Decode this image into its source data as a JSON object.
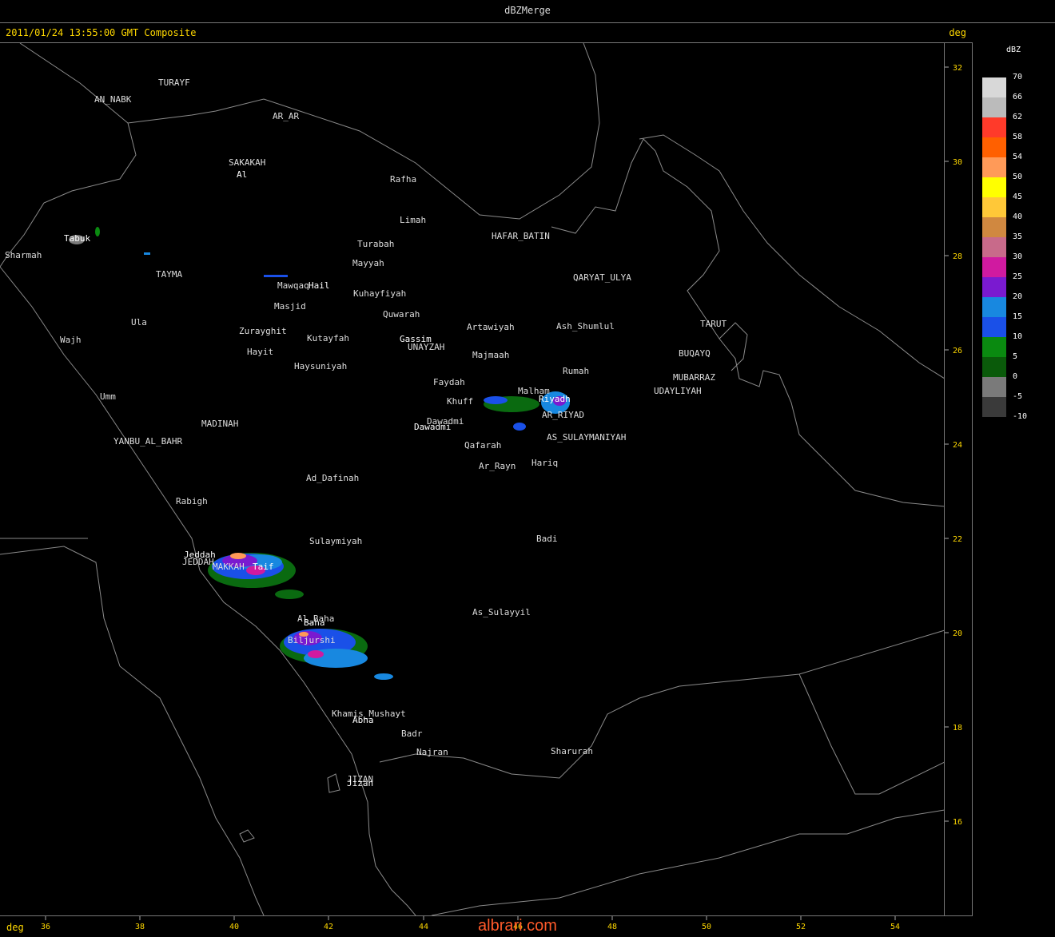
{
  "window": {
    "title": "dBZMerge"
  },
  "header": {
    "timestamp": "2011/01/24 13:55:00 GMT Composite",
    "deg_label": "deg"
  },
  "axes": {
    "deg_label": "deg",
    "lon_ticks": [
      "36",
      "38",
      "40",
      "42",
      "44",
      "46",
      "48",
      "50",
      "52",
      "54"
    ],
    "lat_ticks": [
      "32",
      "30",
      "28",
      "26",
      "24",
      "22",
      "20",
      "18",
      "16"
    ]
  },
  "legend": {
    "unit": "dBZ",
    "items": [
      {
        "label": "70",
        "color": "#d8d8d8"
      },
      {
        "label": "66",
        "color": "#bbbbbb"
      },
      {
        "label": "62",
        "color": "#ff3a2a"
      },
      {
        "label": "58",
        "color": "#ff6000"
      },
      {
        "label": "54",
        "color": "#ff9a58"
      },
      {
        "label": "50",
        "color": "#ffff00"
      },
      {
        "label": "45",
        "color": "#ffc838"
      },
      {
        "label": "40",
        "color": "#d08840"
      },
      {
        "label": "35",
        "color": "#c86a8a"
      },
      {
        "label": "30",
        "color": "#d01aa0"
      },
      {
        "label": "25",
        "color": "#7a1ad0"
      },
      {
        "label": "20",
        "color": "#1888e0"
      },
      {
        "label": "15",
        "color": "#1a50e8"
      },
      {
        "label": "10",
        "color": "#0a8a10"
      },
      {
        "label": "5",
        "color": "#0a5a0a"
      },
      {
        "label": "0",
        "color": "#7a7a7a"
      },
      {
        "label": "-5",
        "color": "#3a3a3a"
      },
      {
        "label": "-10",
        "color": "#000000"
      }
    ]
  },
  "cities": [
    "TURAYF",
    "AN_NABK",
    "AR_AR",
    "SAKAKAH",
    "Al",
    "Rafha",
    "Limah",
    "HAFAR_BATIN",
    "Turabah",
    "Tabuk",
    "Sharmah",
    "TAYMA",
    "Mayyah",
    "Mawqaq",
    "Hail",
    "QARYAT_ULYA",
    "Kuhayfiyah",
    "Masjid",
    "Quwarah",
    "Ula",
    "Zurayghit",
    "Artawiyah",
    "Ash_Shumlul",
    "TARUT",
    "Wajh",
    "Kutayfah",
    "Gassim",
    "UNAYZAH",
    "Hayit",
    "Majmaah",
    "BUQAYQ",
    "Haysuniyah",
    "Rumah",
    "MUBARRAZ",
    "Faydah",
    "UDAYLIYAH",
    "Malham",
    "Riyadh",
    "Umm",
    "Khuff",
    "AR_RIYAD",
    "MADINAH",
    "Dawadmi",
    "Dawadmi",
    "AS_SULAYMANIYAH",
    "YANBU_AL_BAHR",
    "Qafarah",
    "Ar_Rayn",
    "Hariq",
    "Ad_Dafinah",
    "Rabigh",
    "Badi",
    "Sulaymiyah",
    "Jeddah",
    "JEDDAH",
    "MAKKAH",
    "Taif",
    "Al_Baha",
    "Baha",
    "As_Sulayyil",
    "Biljurshi",
    "Khamis_Mushayt",
    "Abha",
    "Badr",
    "Najran",
    "Sharurah",
    "JIZAN",
    "Jizan"
  ],
  "watermark": "albrari.com"
}
